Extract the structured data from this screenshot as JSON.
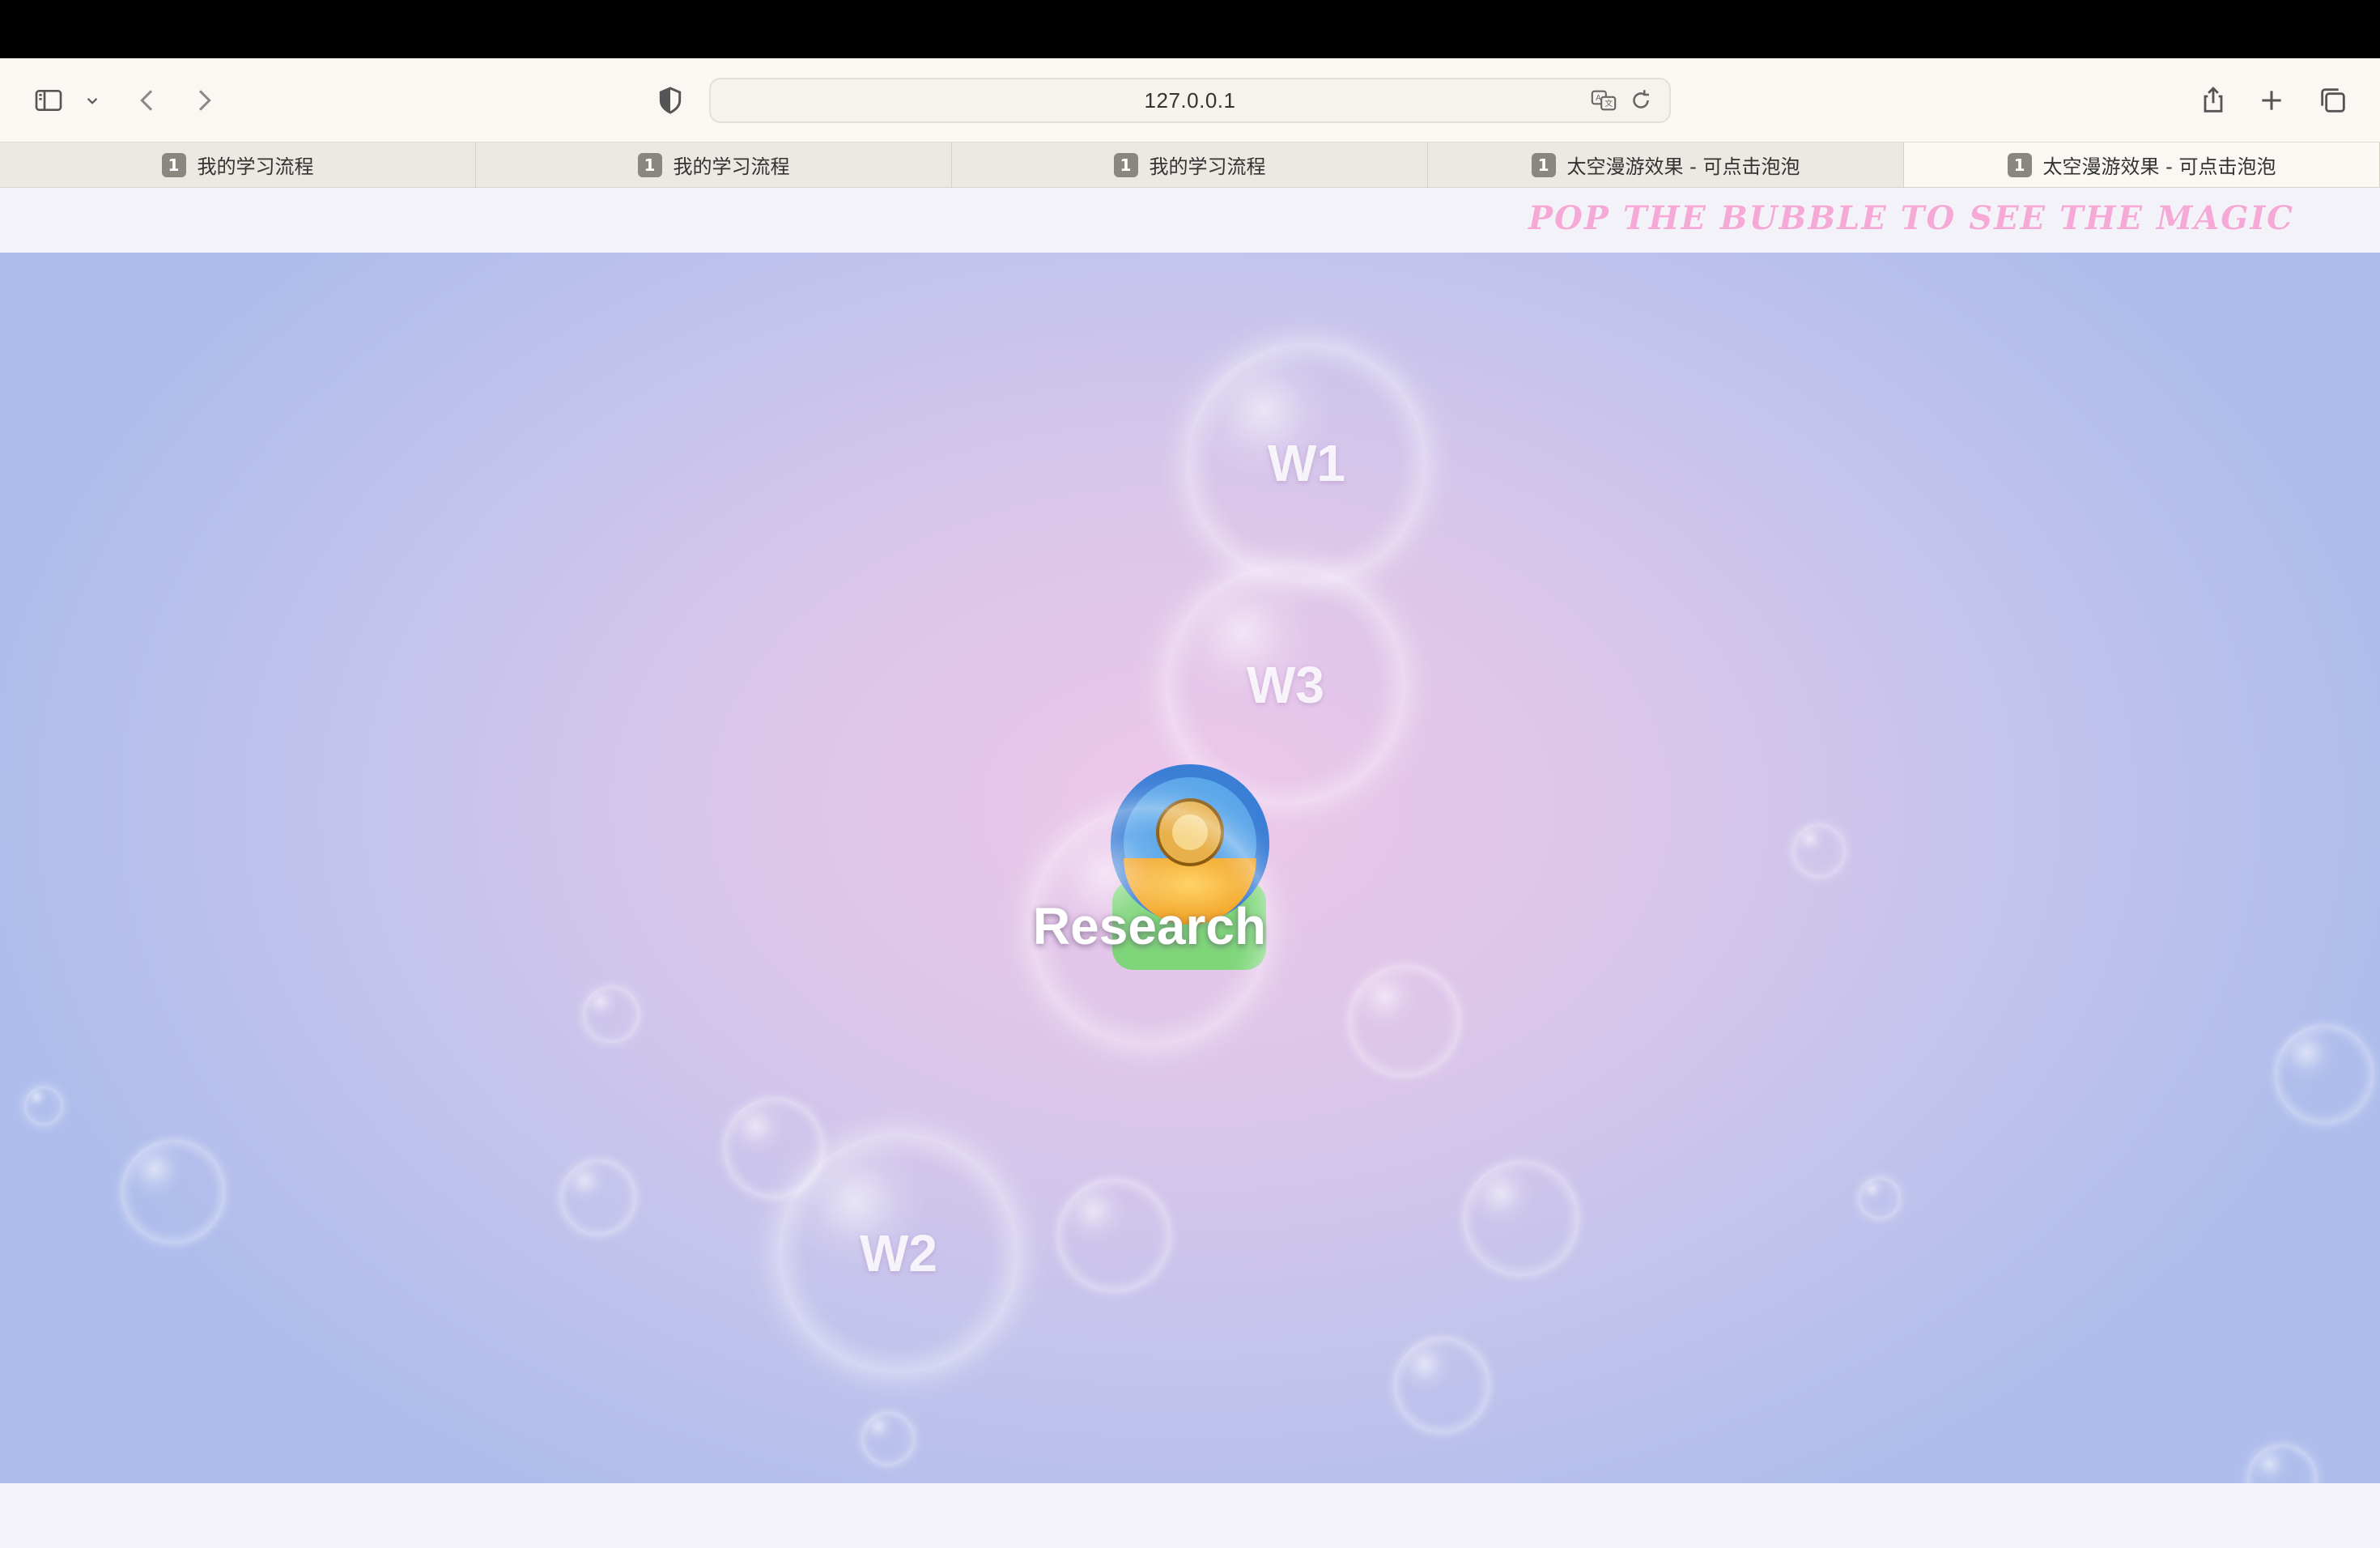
{
  "browser": {
    "url": "127.0.0.1",
    "tabs": [
      {
        "badge": "1",
        "title": "我的学习流程",
        "active": false
      },
      {
        "badge": "1",
        "title": "我的学习流程",
        "active": false
      },
      {
        "badge": "1",
        "title": "我的学习流程",
        "active": false
      },
      {
        "badge": "1",
        "title": "太空漫游效果 - 可点击泡泡",
        "active": false
      },
      {
        "badge": "1",
        "title": "太空漫游效果 - 可点击泡泡",
        "active": true
      }
    ],
    "icons": [
      "sidebar-icon",
      "chevron-down-icon",
      "back-icon",
      "forward-icon",
      "shield-icon",
      "translate-icon",
      "reload-icon",
      "share-icon",
      "new-tab-icon",
      "tab-overview-icon"
    ]
  },
  "page": {
    "tagline": "POP THE BUBBLE TO SEE THE MAGIC",
    "bubbles": {
      "w1": "W1",
      "w3": "W3",
      "research": "Research",
      "w2": "W2"
    }
  },
  "colors": {
    "tagline": "#f4a9d7",
    "stage_center": "#eec6ea",
    "stage_edge": "#aebdec"
  }
}
